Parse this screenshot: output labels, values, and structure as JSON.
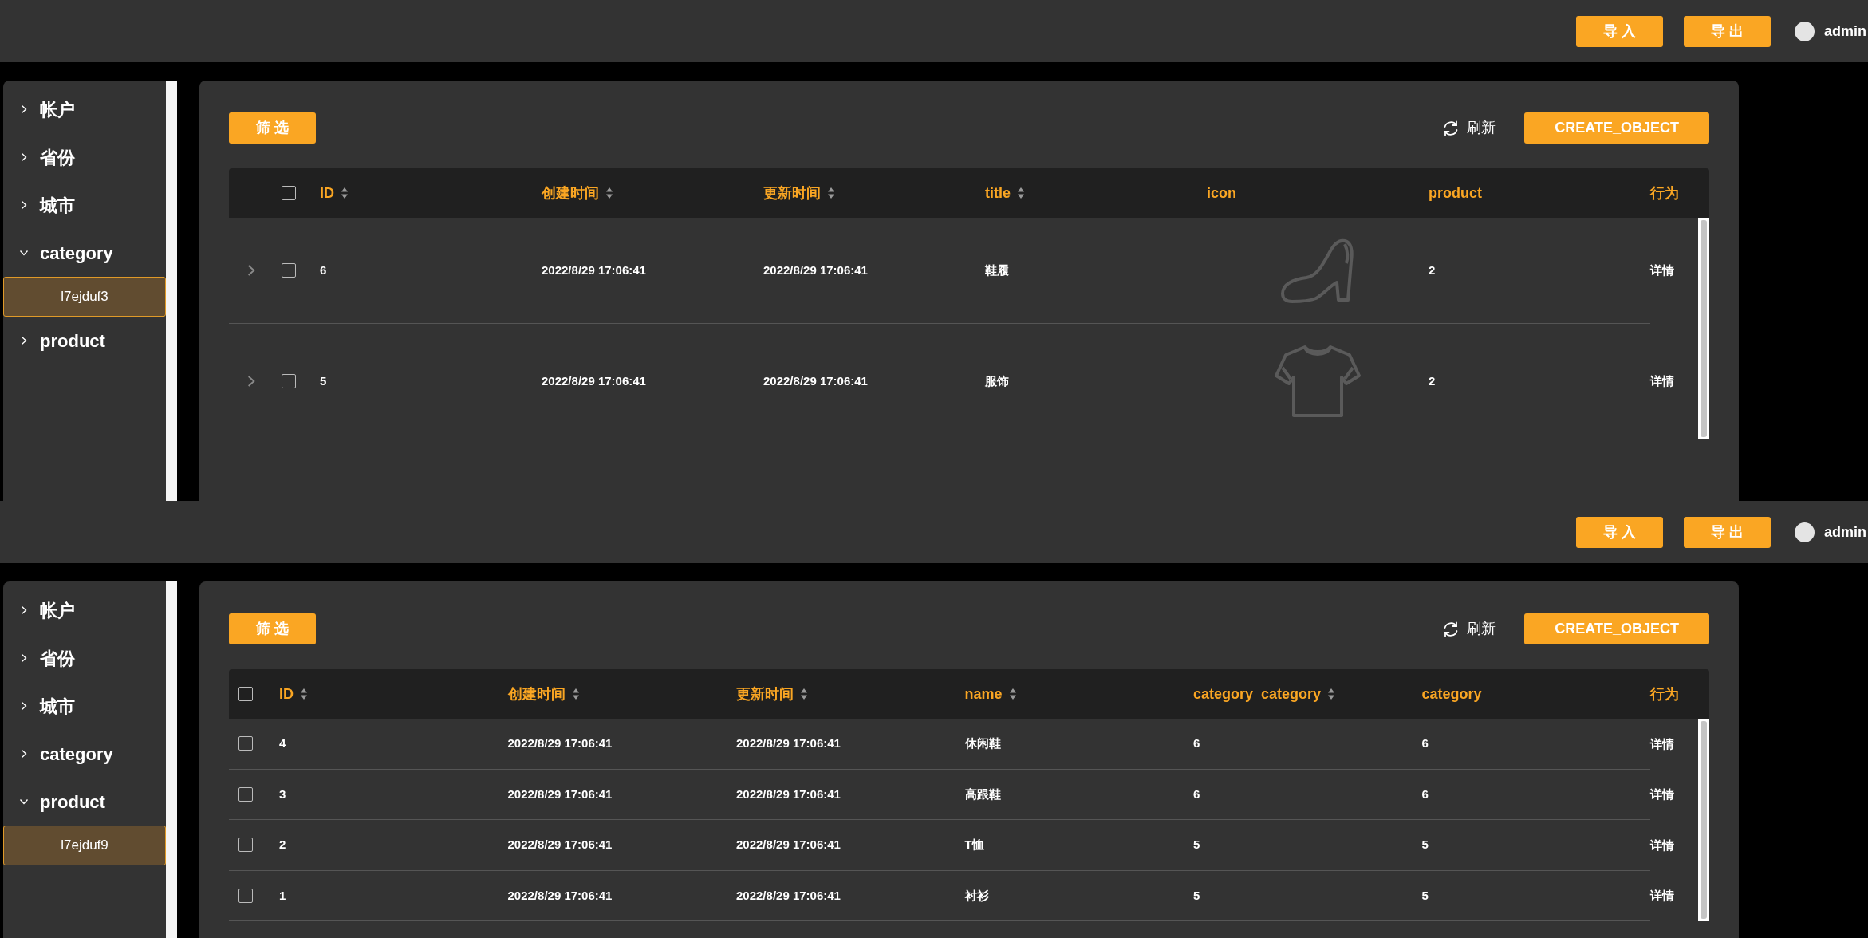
{
  "screens": [
    {
      "topbar": {
        "buttons": [
          "导 入",
          "导 出"
        ],
        "user": "admin"
      },
      "sidebar": {
        "items": [
          {
            "label": "帐户",
            "expanded": false
          },
          {
            "label": "省份",
            "expanded": false
          },
          {
            "label": "城市",
            "expanded": false
          },
          {
            "label": "category",
            "expanded": true,
            "children": [
              {
                "label": "l7ejduf3",
                "selected": true
              }
            ]
          },
          {
            "label": "product",
            "expanded": false
          }
        ]
      },
      "toolbar": {
        "filter": "筛 选",
        "refresh": "刷新",
        "create": "CREATE_OBJECT"
      },
      "table": {
        "expandable": true,
        "header_checked": false,
        "columns": [
          {
            "label": "ID",
            "sortable": true,
            "kind": "text"
          },
          {
            "label": "创建时间",
            "sortable": true,
            "kind": "text"
          },
          {
            "label": "更新时间",
            "sortable": true,
            "kind": "text"
          },
          {
            "label": "title",
            "sortable": true,
            "kind": "text"
          },
          {
            "label": "icon",
            "sortable": false,
            "kind": "icon"
          },
          {
            "label": "product",
            "sortable": false,
            "kind": "text"
          },
          {
            "label": "行为",
            "sortable": false,
            "kind": "action"
          }
        ],
        "rows": [
          {
            "checked": false,
            "expanded": false,
            "cells": [
              "6",
              "2022/8/29 17:06:41",
              "2022/8/29 17:06:41",
              "鞋履",
              "",
              "2",
              "详情"
            ]
          },
          {
            "checked": false,
            "expanded": false,
            "cells": [
              "5",
              "2022/8/29 17:06:41",
              "2022/8/29 17:06:41",
              "服饰",
              "",
              "2",
              "详情"
            ]
          }
        ]
      }
    },
    {
      "topbar": {
        "buttons": [
          "导 入",
          "导 出"
        ],
        "user": "admin"
      },
      "sidebar": {
        "items": [
          {
            "label": "帐户",
            "expanded": false
          },
          {
            "label": "省份",
            "expanded": false
          },
          {
            "label": "城市",
            "expanded": false
          },
          {
            "label": "category",
            "expanded": false
          },
          {
            "label": "product",
            "expanded": true,
            "children": [
              {
                "label": "l7ejduf9",
                "selected": true
              }
            ]
          }
        ]
      },
      "toolbar": {
        "filter": "筛 选",
        "refresh": "刷新",
        "create": "CREATE_OBJECT"
      },
      "table": {
        "expandable": false,
        "header_checked": false,
        "columns": [
          {
            "label": "ID",
            "sortable": true,
            "kind": "text"
          },
          {
            "label": "创建时间",
            "sortable": true,
            "kind": "text"
          },
          {
            "label": "更新时间",
            "sortable": true,
            "kind": "text"
          },
          {
            "label": "name",
            "sortable": true,
            "kind": "text"
          },
          {
            "label": "category_category",
            "sortable": true,
            "kind": "text"
          },
          {
            "label": "category",
            "sortable": false,
            "kind": "text"
          },
          {
            "label": "行为",
            "sortable": false,
            "kind": "action"
          }
        ],
        "rows": [
          {
            "checked": false,
            "cells": [
              "4",
              "2022/8/29 17:06:41",
              "2022/8/29 17:06:41",
              "休闲鞋",
              "6",
              "6",
              "详情"
            ]
          },
          {
            "checked": false,
            "cells": [
              "3",
              "2022/8/29 17:06:41",
              "2022/8/29 17:06:41",
              "高跟鞋",
              "6",
              "6",
              "详情"
            ]
          },
          {
            "checked": false,
            "cells": [
              "2",
              "2022/8/29 17:06:41",
              "2022/8/29 17:06:41",
              "T恤",
              "5",
              "5",
              "详情"
            ]
          },
          {
            "checked": false,
            "cells": [
              "1",
              "2022/8/29 17:06:41",
              "2022/8/29 17:06:41",
              "衬衫",
              "5",
              "5",
              "详情"
            ]
          }
        ]
      }
    }
  ]
}
